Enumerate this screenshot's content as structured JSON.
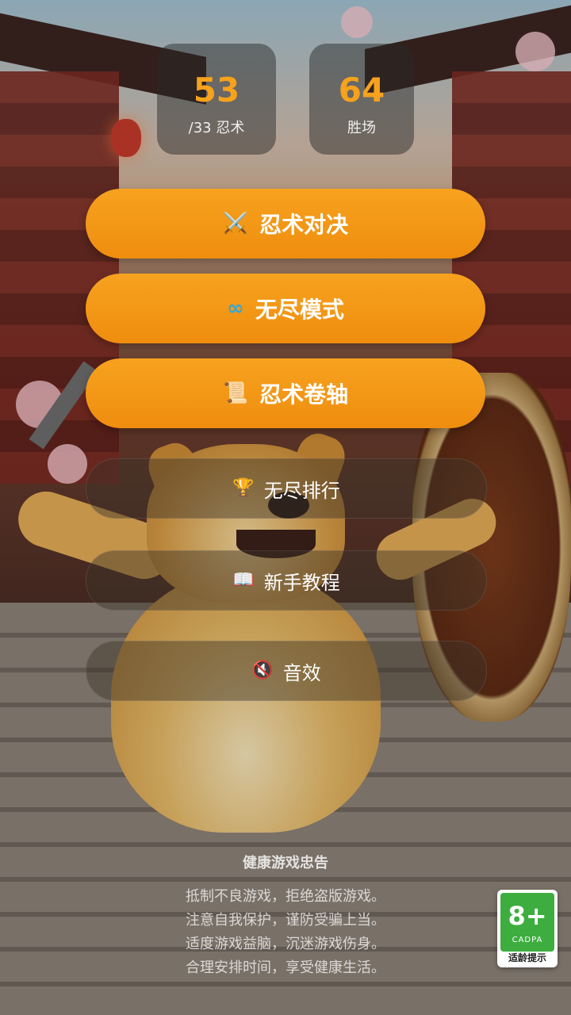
{
  "stats": [
    {
      "value": "53",
      "label": "/33 忍术"
    },
    {
      "value": "64",
      "label": "胜场"
    }
  ],
  "primary_buttons": [
    {
      "icon": "⚔️",
      "label": "忍术对决",
      "icon_name": "crossed-swords-icon"
    },
    {
      "icon": "∞",
      "label": "无尽模式",
      "icon_name": "infinity-icon"
    },
    {
      "icon": "📜",
      "label": "忍术卷轴",
      "icon_name": "scroll-icon"
    }
  ],
  "secondary_buttons": [
    {
      "icon": "🏆",
      "label": "无尽排行",
      "icon_name": "trophy-icon"
    },
    {
      "icon": "📖",
      "label": "新手教程",
      "icon_name": "book-icon"
    },
    {
      "icon": "🔇",
      "label": "音效",
      "icon_name": "mute-icon"
    }
  ],
  "health_advice": {
    "title": "健康游戏忠告",
    "lines": [
      "抵制不良游戏，拒绝盗版游戏。",
      "注意自我保护，谨防受骗上当。",
      "适度游戏益脑，沉迷游戏伤身。",
      "合理安排时间，享受健康生活。"
    ]
  },
  "age_rating": {
    "value": "8+",
    "org": "CADPA",
    "tip": "适龄提示"
  },
  "colors": {
    "accent": "#f6a21c",
    "button": "#f29512",
    "rating_green": "#3dad3f"
  }
}
